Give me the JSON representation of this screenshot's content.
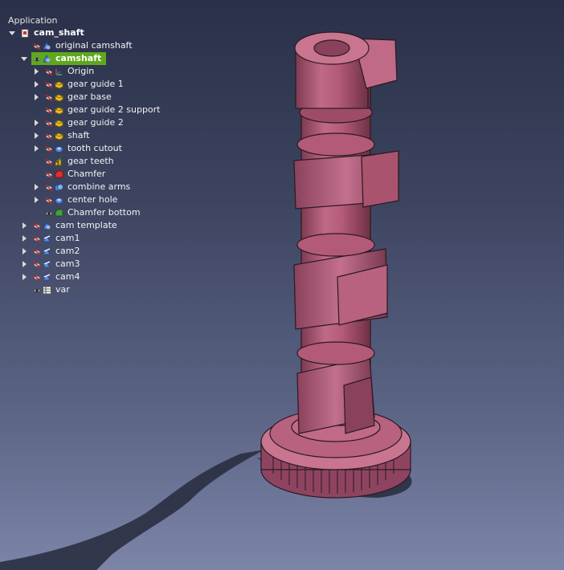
{
  "tree": {
    "header": "Application",
    "items": [
      {
        "label": "cam_shaft",
        "level": 0,
        "arrow": "down",
        "vis": "none",
        "icon": "document-icon",
        "bold": true
      },
      {
        "label": "original camshaft",
        "level": 1,
        "arrow": "none",
        "vis": "hidden",
        "icon": "body-icon"
      },
      {
        "label": "camshaft",
        "level": 1,
        "arrow": "down",
        "vis": "visible",
        "icon": "body-icon",
        "bold": true,
        "selected": true
      },
      {
        "label": "Origin",
        "level": 2,
        "arrow": "right",
        "vis": "hidden",
        "icon": "origin-icon"
      },
      {
        "label": "gear guide 1",
        "level": 2,
        "arrow": "right",
        "vis": "hidden",
        "icon": "pad-icon"
      },
      {
        "label": "gear base",
        "level": 2,
        "arrow": "right",
        "vis": "hidden",
        "icon": "pad-icon"
      },
      {
        "label": "gear guide 2 support",
        "level": 2,
        "arrow": "none",
        "vis": "hidden",
        "icon": "pad-icon"
      },
      {
        "label": "gear guide 2",
        "level": 2,
        "arrow": "right",
        "vis": "hidden",
        "icon": "pad-icon"
      },
      {
        "label": "shaft",
        "level": 2,
        "arrow": "right",
        "vis": "hidden",
        "icon": "pad-icon"
      },
      {
        "label": "tooth cutout",
        "level": 2,
        "arrow": "right",
        "vis": "hidden",
        "icon": "pocket-icon"
      },
      {
        "label": "gear teeth",
        "level": 2,
        "arrow": "none",
        "vis": "hidden",
        "icon": "polar-pattern-icon"
      },
      {
        "label": "Chamfer",
        "level": 2,
        "arrow": "none",
        "vis": "hidden",
        "icon": "chamfer-icon"
      },
      {
        "label": "combine arms",
        "level": 2,
        "arrow": "right",
        "vis": "hidden",
        "icon": "boolean-icon"
      },
      {
        "label": "center hole",
        "level": 2,
        "arrow": "right",
        "vis": "hidden",
        "icon": "pocket-icon"
      },
      {
        "label": "Chamfer bottom",
        "level": 2,
        "arrow": "none",
        "vis": "visible",
        "icon": "chamfer-tip-icon"
      },
      {
        "label": "cam template",
        "level": 1,
        "arrow": "right",
        "vis": "hidden",
        "icon": "body-icon"
      },
      {
        "label": "cam1",
        "level": 1,
        "arrow": "right",
        "vis": "hidden",
        "icon": "body-link-icon"
      },
      {
        "label": "cam2",
        "level": 1,
        "arrow": "right",
        "vis": "hidden",
        "icon": "body-link-icon"
      },
      {
        "label": "cam3",
        "level": 1,
        "arrow": "right",
        "vis": "hidden",
        "icon": "body-link-icon"
      },
      {
        "label": "cam4",
        "level": 1,
        "arrow": "right",
        "vis": "hidden",
        "icon": "body-link-icon"
      },
      {
        "label": "var",
        "level": 1,
        "arrow": "none",
        "vis": "visible",
        "icon": "spreadsheet-icon"
      }
    ]
  },
  "colors": {
    "selection": "#5fa81e",
    "part_face": "#b35a78",
    "part_edge": "#2a1a22"
  }
}
